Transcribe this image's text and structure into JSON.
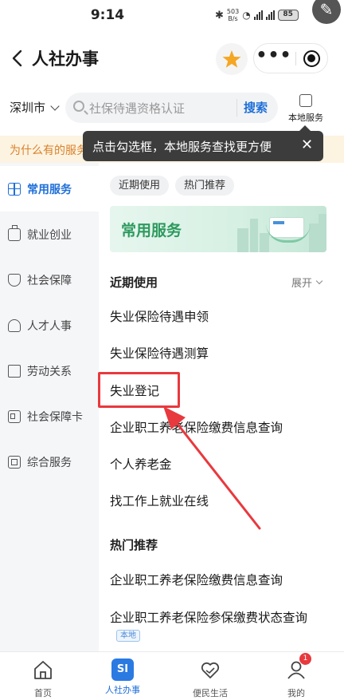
{
  "status_bar": {
    "time": "9:14",
    "net_speed_top": "503",
    "net_speed_bottom": "B/s",
    "battery": "85"
  },
  "header": {
    "title": "人社办事"
  },
  "search": {
    "city": "深圳市",
    "placeholder": "社保待遇资格认证",
    "button": "搜索",
    "local_service_label": "本地服务"
  },
  "notice": {
    "text": "为什么有的服务"
  },
  "tooltip": {
    "text": "点击勾选框，本地服务查找更方便"
  },
  "sidebar": {
    "items": [
      {
        "label": "常用服务",
        "active": true,
        "icon": "grid-icon"
      },
      {
        "label": "就业创业",
        "active": false,
        "icon": "briefcase-icon"
      },
      {
        "label": "社会保障",
        "active": false,
        "icon": "shield-icon"
      },
      {
        "label": "人才人事",
        "active": false,
        "icon": "person-icon"
      },
      {
        "label": "劳动关系",
        "active": false,
        "icon": "book-icon"
      },
      {
        "label": "社会保障卡",
        "active": false,
        "icon": "id-card-icon"
      },
      {
        "label": "综合服务",
        "active": false,
        "icon": "square-icon"
      }
    ]
  },
  "main": {
    "chips": [
      "近期使用",
      "热门推荐"
    ],
    "banner_title": "常用服务",
    "recent": {
      "title": "近期使用",
      "expand": "展开",
      "items": [
        "失业保险待遇申领",
        "失业保险待遇测算",
        "失业登记",
        "企业职工养老保险缴费信息查询",
        "个人养老金",
        "找工作上就业在线"
      ]
    },
    "hot": {
      "title": "热门推荐",
      "items": [
        "企业职工养老保险缴费信息查询",
        "企业职工养老保险参保缴费状态查询"
      ],
      "tag": "本地"
    }
  },
  "tabbar": {
    "items": [
      {
        "label": "首页",
        "icon": "home-icon",
        "active": false
      },
      {
        "label": "人社办事",
        "icon": "si-icon",
        "active": true,
        "icon_text": "SI"
      },
      {
        "label": "便民生活",
        "icon": "heart-hands-icon",
        "active": false
      },
      {
        "label": "我的",
        "icon": "user-icon",
        "active": false
      }
    ],
    "badge": "1"
  },
  "colors": {
    "accent": "#1f6fd8",
    "highlight": "#e8393e",
    "notice_text": "#d9822b",
    "banner_green": "#2d9a5e"
  }
}
